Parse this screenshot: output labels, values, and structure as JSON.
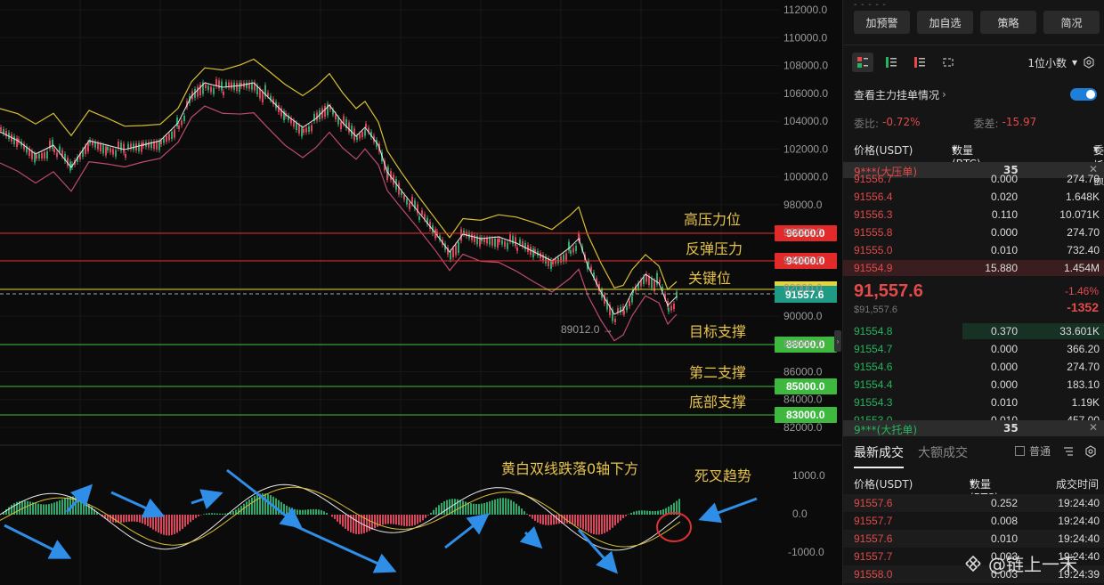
{
  "chart": {
    "price_axis": [
      "112000.0",
      "110000.0",
      "108000.0",
      "106000.0",
      "104000.0",
      "102000.0",
      "100000.0",
      "98000.0",
      "96000.0",
      "94000.0",
      "92000.0",
      "90000.0",
      "88000.0",
      "86000.0",
      "84000.0",
      "82000.0"
    ],
    "macd_axis": [
      "1000.0",
      "0.0",
      "-1000.0"
    ],
    "levels": [
      {
        "label": "高压力位",
        "value": "96000.0",
        "color": "#e32a2a"
      },
      {
        "label": "反弹压力",
        "value": "94000.0",
        "color": "#e32a2a"
      },
      {
        "label": "关键位",
        "value": "",
        "color": "#e6d23a"
      },
      {
        "label": "目标支撑",
        "value": "88000.0",
        "color": "#3fb83f"
      },
      {
        "label": "第二支撑",
        "value": "85000.0",
        "color": "#3fb83f"
      },
      {
        "label": "底部支撑",
        "value": "83000.0",
        "color": "#3fb83f"
      }
    ],
    "current_price_tag": "91557.6",
    "low_marker": "89012.0 →",
    "macd_annotation": "黄白双线跌落0轴下方",
    "trend_annotation": "死叉趋势"
  },
  "panel": {
    "buttons": [
      "加预警",
      "加自选",
      "策略",
      "简况"
    ],
    "decimals": "1位小数",
    "watch_label": "查看主力挂单情况",
    "ratio_label": "委比:",
    "ratio_value": "-0.72%",
    "diff_label": "委差:",
    "diff_value": "-15.97",
    "ob_headers": {
      "price": "价格(USDT)",
      "qty": "数量 (BTC)",
      "amount": "委托额"
    },
    "big_ask": {
      "name": "9***(大压单)",
      "qty": "35"
    },
    "asks": [
      {
        "price": "91556.7",
        "qty": "0.000",
        "amount": "274.70"
      },
      {
        "price": "91556.4",
        "qty": "0.020",
        "amount": "1.648K"
      },
      {
        "price": "91556.3",
        "qty": "0.110",
        "amount": "10.071K"
      },
      {
        "price": "91555.8",
        "qty": "0.000",
        "amount": "274.70"
      },
      {
        "price": "91555.0",
        "qty": "0.010",
        "amount": "732.40"
      },
      {
        "price": "91554.9",
        "qty": "15.880",
        "amount": "1.454M"
      }
    ],
    "mid_price": "91,557.6",
    "mid_sub": "$91,557.6",
    "mid_pct": "-1.46%",
    "mid_change": "-1352",
    "bids": [
      {
        "price": "91554.8",
        "qty": "0.370",
        "amount": "33.601K"
      },
      {
        "price": "91554.7",
        "qty": "0.000",
        "amount": "366.20"
      },
      {
        "price": "91554.6",
        "qty": "0.000",
        "amount": "274.70"
      },
      {
        "price": "91554.4",
        "qty": "0.000",
        "amount": "183.10"
      },
      {
        "price": "91554.3",
        "qty": "0.010",
        "amount": "1.19K"
      },
      {
        "price": "91553.0",
        "qty": "0.010",
        "amount": "457.00"
      }
    ],
    "big_bid": {
      "name": "9***(大托单)",
      "qty": "35"
    },
    "tabs": [
      "最新成交",
      "大额成交"
    ],
    "normal_label": "普通",
    "trade_headers": {
      "price": "价格(USDT)",
      "qty": "数量(BTC)",
      "time": "成交时间"
    },
    "trades": [
      {
        "price": "91557.6",
        "qty": "0.252",
        "time": "19:24:40"
      },
      {
        "price": "91557.7",
        "qty": "0.008",
        "time": "19:24:40"
      },
      {
        "price": "91557.6",
        "qty": "0.010",
        "time": "19:24:40"
      },
      {
        "price": "91557.7",
        "qty": "0.003",
        "time": "19:24:40"
      },
      {
        "price": "91558.0",
        "qty": "0.003",
        "time": "19:24:39"
      }
    ],
    "watermark": "@链上一禾"
  }
}
